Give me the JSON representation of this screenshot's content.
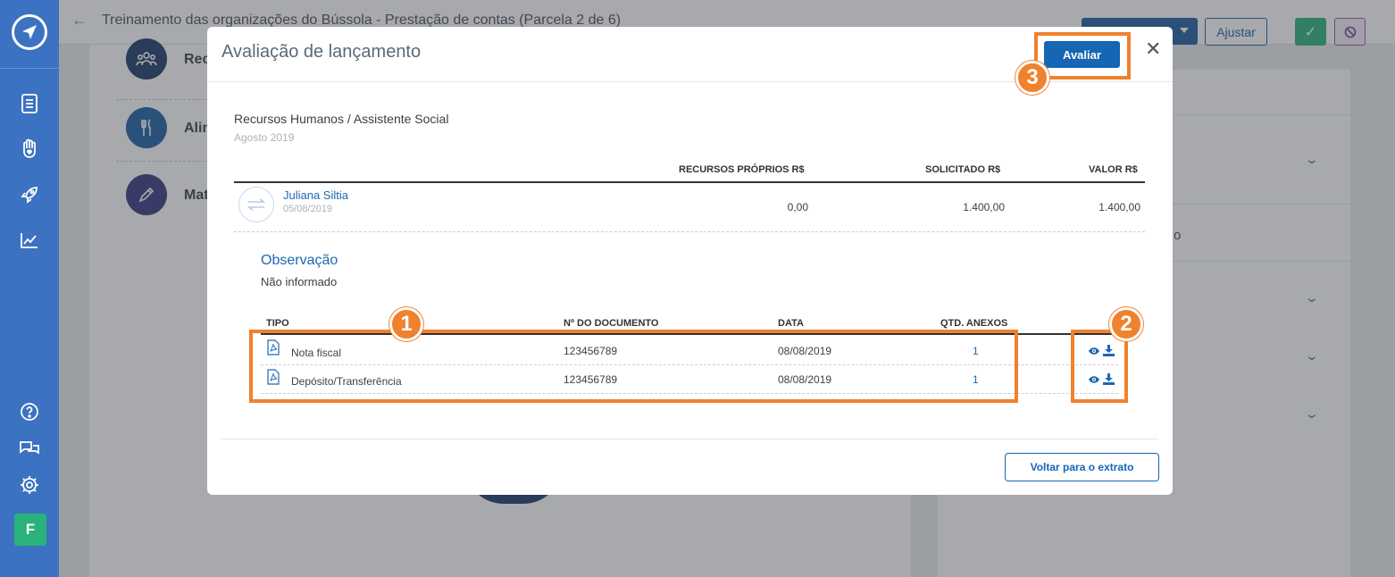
{
  "app": {
    "page_title": "Treinamento das organizações do Bússola - Prestação de contas (Parcela 2 de 6)",
    "adjust_label": "Ajustar",
    "avatar_letter": "F"
  },
  "background": {
    "categories": [
      {
        "label": "Rec",
        "color": "#1a3968",
        "icon": "people-icon"
      },
      {
        "label": "Alin",
        "color": "#1a5fa3",
        "icon": "cutlery-icon"
      },
      {
        "label": "Mat",
        "color": "#3a3680",
        "icon": "pencil-icon"
      }
    ],
    "right_panel_text": "o"
  },
  "modal": {
    "title": "Avaliação de lançamento",
    "evaluate_label": "Avaliar",
    "close_symbol": "✕",
    "section_title": "Recursos Humanos / Assistente Social",
    "section_date": "Agosto 2019",
    "columns": {
      "own_resources": "RECURSOS PRÓPRIOS R$",
      "requested": "SOLICITADO R$",
      "value": "VALOR R$"
    },
    "entry": {
      "name": "Juliana Siltia",
      "date": "05/08/2019",
      "own_resources": "0,00",
      "requested": "1.400,00",
      "value": "1.400,00"
    },
    "observation_title": "Observação",
    "observation_text": "Não informado",
    "doc_columns": {
      "type": "TIPO",
      "number": "Nº DO DOCUMENTO",
      "date": "DATA",
      "attachments": "QTD. ANEXOS"
    },
    "documents": [
      {
        "type": "Nota fiscal",
        "number": "123456789",
        "date": "08/08/2019",
        "attachments": "1"
      },
      {
        "type": "Depósito/Transferência",
        "number": "123456789",
        "date": "08/08/2019",
        "attachments": "1"
      }
    ],
    "back_label": "Voltar para o extrato"
  },
  "annotations": {
    "badge_1": "1",
    "badge_2": "2",
    "badge_3": "3",
    "highlight_color": "#f0812d"
  }
}
